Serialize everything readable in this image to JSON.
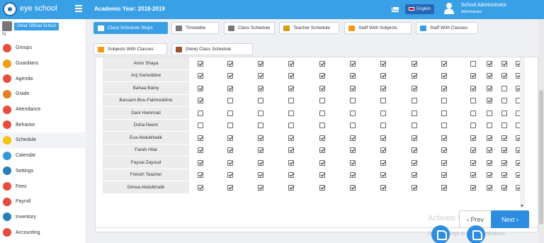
{
  "header": {
    "brand": "eye school",
    "academic_year": "Academic Year: 2018-2019",
    "language": "English",
    "user_name": "School Administrator",
    "user_role": "Administrator"
  },
  "sidebar": {
    "school_name": "Omar Official School",
    "school_code": "ع/ا",
    "items": [
      {
        "label": "Groups",
        "icon": "groups-icon",
        "color": "#e74c3c"
      },
      {
        "label": "Guardians",
        "icon": "guardians-icon",
        "color": "#f39c12"
      },
      {
        "label": "Agenda",
        "icon": "agenda-icon",
        "color": "#e74c3c"
      },
      {
        "label": "Grade",
        "icon": "grade-icon",
        "color": "#e67e22"
      },
      {
        "label": "Attendance",
        "icon": "attendance-icon",
        "color": "#e74c3c"
      },
      {
        "label": "Behavior",
        "icon": "behavior-icon",
        "color": "#e74c3c"
      },
      {
        "label": "Schedule",
        "icon": "schedule-icon",
        "color": "#f1c40f"
      },
      {
        "label": "Calendar",
        "icon": "calendar-icon",
        "color": "#3498db"
      },
      {
        "label": "Settings",
        "icon": "settings-icon",
        "color": "#2980b9"
      },
      {
        "label": "Fees",
        "icon": "fees-icon",
        "color": "#e74c3c"
      },
      {
        "label": "Payroll",
        "icon": "payroll-icon",
        "color": "#e74c3c"
      },
      {
        "label": "Inventory",
        "icon": "inventory-icon",
        "color": "#2980b9"
      },
      {
        "label": "Accounting",
        "icon": "accounting-icon",
        "color": "#e74c3c"
      }
    ],
    "active_index": 6
  },
  "tabs": [
    {
      "label": "Class Schedule Steps",
      "active": true
    },
    {
      "label": "Timetable",
      "active": false
    },
    {
      "label": "Class Schedule",
      "active": false
    },
    {
      "label": "Teacher Schedule",
      "active": false
    },
    {
      "label": "Staff With Subjects",
      "active": false
    },
    {
      "label": "Staff With Classes",
      "active": false
    },
    {
      "label": "Subjects With Classes",
      "active": false
    },
    {
      "label": "(New) Class Schedule",
      "active": false
    }
  ],
  "table": {
    "rows": [
      {
        "name": "Amin Shaya",
        "checks": [
          1,
          1,
          1,
          1,
          1,
          1,
          1,
          1,
          1,
          0,
          1,
          1,
          1
        ]
      },
      {
        "name": "Arij Sarieddine",
        "checks": [
          1,
          1,
          1,
          1,
          1,
          1,
          1,
          1,
          1,
          1,
          1,
          1,
          1
        ]
      },
      {
        "name": "Bahaa Bainy",
        "checks": [
          1,
          1,
          1,
          1,
          1,
          1,
          1,
          1,
          1,
          1,
          1,
          0,
          1
        ]
      },
      {
        "name": "Bassam Bou-Fakhreddine",
        "checks": [
          1,
          0,
          0,
          0,
          0,
          0,
          0,
          0,
          0,
          0,
          1,
          0,
          0
        ]
      },
      {
        "name": "Dani Hammad",
        "checks": [
          0,
          0,
          0,
          0,
          0,
          0,
          0,
          0,
          0,
          0,
          0,
          0,
          0
        ]
      },
      {
        "name": "Doha Neem",
        "checks": [
          0,
          0,
          0,
          0,
          0,
          0,
          0,
          0,
          0,
          0,
          0,
          0,
          0
        ]
      },
      {
        "name": "Eva Abdulkhalik",
        "checks": [
          1,
          1,
          1,
          1,
          1,
          1,
          1,
          1,
          1,
          1,
          1,
          1,
          1
        ]
      },
      {
        "name": "Farah Hilal",
        "checks": [
          1,
          1,
          1,
          1,
          1,
          1,
          1,
          1,
          1,
          1,
          1,
          1,
          1
        ]
      },
      {
        "name": "Faysal Zayoud",
        "checks": [
          1,
          1,
          1,
          1,
          1,
          1,
          1,
          1,
          1,
          1,
          1,
          1,
          1
        ]
      },
      {
        "name": "French Teacher",
        "checks": [
          1,
          1,
          1,
          1,
          1,
          1,
          1,
          1,
          1,
          1,
          1,
          1,
          1
        ]
      },
      {
        "name": "Ginwa Abdulkhalik",
        "checks": [
          1,
          1,
          1,
          1,
          1,
          1,
          1,
          1,
          1,
          1,
          1,
          1,
          1
        ]
      }
    ]
  },
  "pager": {
    "prev": "‹ Prev",
    "next": "Next ›"
  },
  "watermark": {
    "line1": "Activate Windows",
    "line2": "Go to Settings to activate Windows."
  },
  "colors": {
    "brand": "#3aa0e6",
    "next": "#2e8de0"
  }
}
